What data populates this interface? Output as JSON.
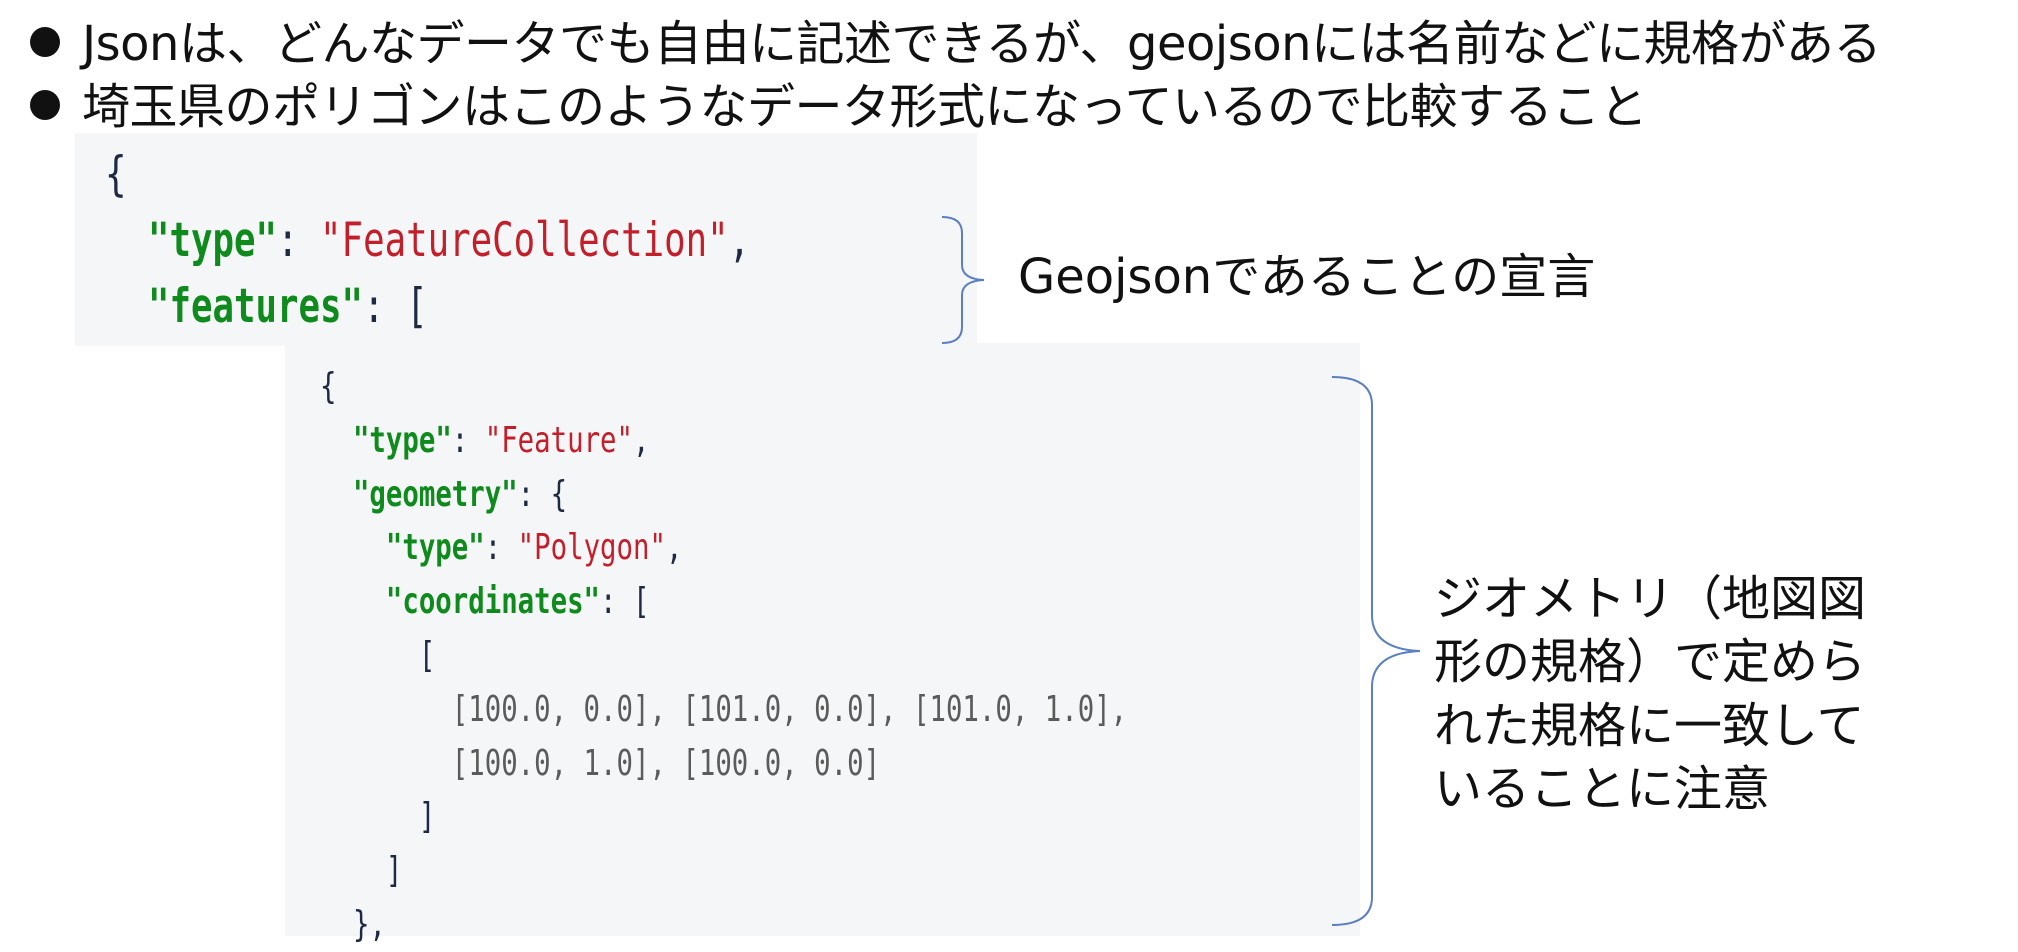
{
  "bullets": [
    "Jsonは、どんなデータでも自由に記述できるが、geojsonには名前などに規格がある",
    "埼玉県のポリゴンはこのようなデータ形式になっているので比較すること"
  ],
  "code_top": {
    "open_brace": "{",
    "type_key": "\"type\"",
    "colon": ": ",
    "type_value": "\"FeatureCollection\"",
    "comma": ",",
    "features_key": "\"features\"",
    "open_bracket": "["
  },
  "code_main": {
    "open_brace": "{",
    "type_key": "\"type\"",
    "type_value": "\"Feature\"",
    "geometry_key": "\"geometry\"",
    "geometry_open": "{",
    "geom_type_key": "\"type\"",
    "geom_type_value": "\"Polygon\"",
    "coordinates_key": "\"coordinates\"",
    "coordinates_open": "[",
    "ring_open": "[",
    "coords_line_1": "[100.0, 0.0], [101.0, 0.0], [101.0, 1.0],",
    "coords_line_2": "[100.0, 1.0], [100.0, 0.0]",
    "ring_close": "]",
    "coordinates_close": "]",
    "feature_close": "},"
  },
  "annotations": {
    "geojson_declaration": "Geojsonであることの宣言",
    "geometry_note_lines": [
      "ジオメトリ（地図図",
      "形の規格）で定めら",
      "れた規格に一致して",
      "いることに注意"
    ]
  },
  "colors": {
    "key": "#0f8a1c",
    "string": "#c21f2a",
    "number": "#5b5b5b",
    "punctuation": "#1e2a44",
    "code_background": "#f5f6f8",
    "brace_line": "#5b7fbf"
  }
}
